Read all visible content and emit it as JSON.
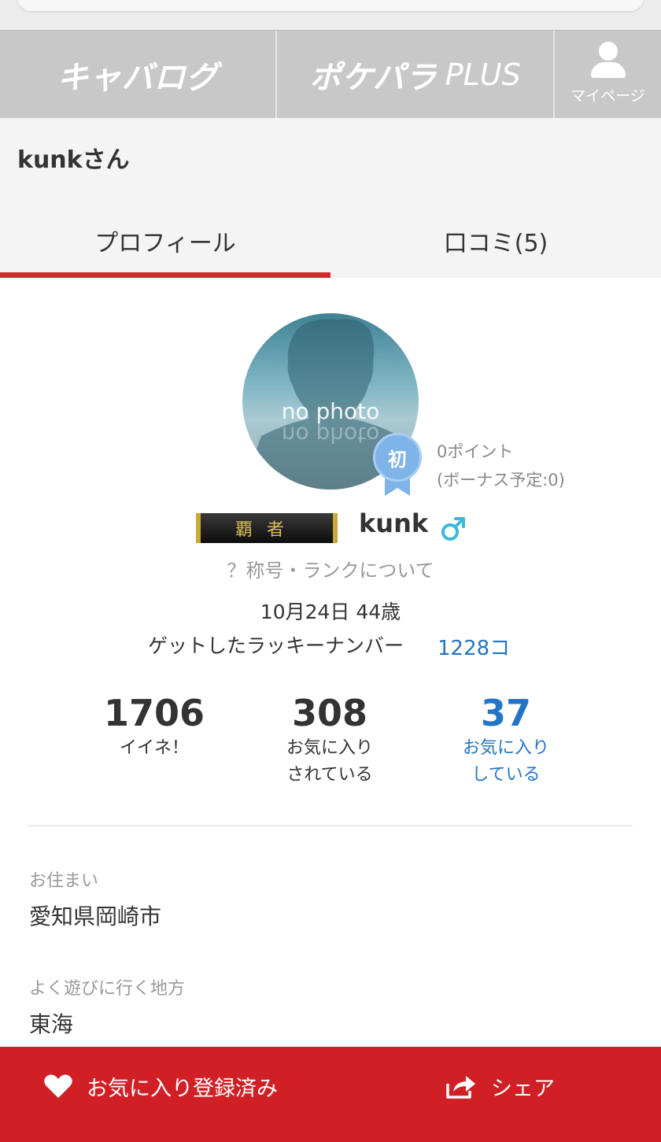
{
  "nav": {
    "logo1": "キャバログ",
    "logo2": "ポケパラ",
    "logo2_suffix": "PLUS",
    "mypage_label": "マイページ"
  },
  "user": {
    "title": "kunkさん",
    "name": "kunk",
    "avatar_text": "no photo",
    "rank_badge": "初",
    "points": "0ポイント",
    "bonus": "(ボーナス予定:0)",
    "title_plate": "覇者",
    "rank_link": "？称号・ランクについて",
    "birthday": "10月24日 44歳",
    "lucky_label": "ゲットしたラッキーナンバー",
    "lucky_count": "1228コ"
  },
  "tabs": [
    {
      "label": "プロフィール",
      "active": true
    },
    {
      "label": "口コミ(5)",
      "active": false
    }
  ],
  "stats": [
    {
      "value": "1706",
      "label1": "イイネ！",
      "label2": ""
    },
    {
      "value": "308",
      "label1": "お気に入り",
      "label2": "されている"
    },
    {
      "value": "37",
      "label1": "お気に入り",
      "label2": "している"
    }
  ],
  "fields": [
    {
      "label": "お住まい",
      "value": "愛知県岡崎市"
    },
    {
      "label": "よく遊びに行く地方",
      "value": "東海"
    }
  ],
  "bottom": {
    "favorite_label": "お気に入り登録済み",
    "share_label": "シェア"
  },
  "colors": {
    "accent_red": "#d02026",
    "link_blue": "#2374c6",
    "gender_icon": "#3cb8d8"
  },
  "icons": {
    "mypage": "person-icon",
    "gender": "male-icon",
    "favorite": "heart-icon",
    "share": "share-icon"
  }
}
